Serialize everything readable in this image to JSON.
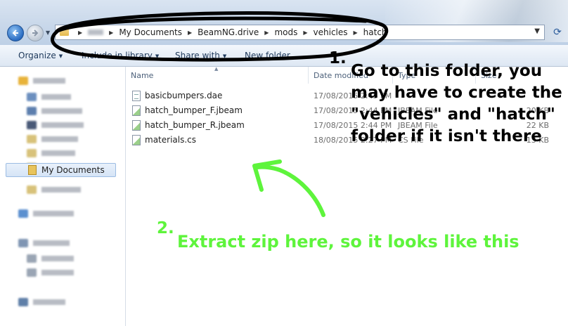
{
  "address": {
    "crumbs": [
      "My Documents",
      "BeamNG.drive",
      "mods",
      "vehicles",
      "hatch"
    ]
  },
  "toolbar": {
    "organize": "Organize",
    "include_in_library": "Include in library",
    "share_with": "Share with",
    "new_folder": "New folder"
  },
  "sidebar": {
    "selected": "My Documents"
  },
  "columns": {
    "name": "Name",
    "date_modified": "Date modified",
    "type": "Type",
    "size": "Size"
  },
  "files": [
    {
      "name": "basicbumpers.dae",
      "date": "17/08/2015 2:45 PM",
      "type": "",
      "size": ""
    },
    {
      "name": "hatch_bumper_F.jbeam",
      "date": "17/08/2015 2:44 PM",
      "type": "JBEAM File",
      "size": "20 KB"
    },
    {
      "name": "hatch_bumper_R.jbeam",
      "date": "17/08/2015 2:44 PM",
      "type": "JBEAM File",
      "size": "22 KB"
    },
    {
      "name": "materials.cs",
      "date": "18/08/2015 2:27 PM",
      "type": "CS File",
      "size": "13 KB"
    }
  ],
  "annotations": {
    "step1_number": "1.",
    "step1_text": "Go to this folder, you may have to create the \"vehicles\" and \"hatch\" folder if it isn't there",
    "step2_number": "2.",
    "step2_text": "Extract zip here, so it looks like this",
    "step1_color": "#000000",
    "step2_color": "#5ef43c"
  }
}
